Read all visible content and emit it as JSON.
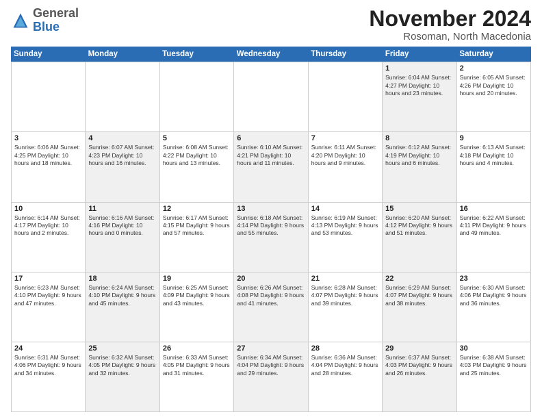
{
  "logo": {
    "general": "General",
    "blue": "Blue"
  },
  "title": "November 2024",
  "subtitle": "Rosoman, North Macedonia",
  "days_of_week": [
    "Sunday",
    "Monday",
    "Tuesday",
    "Wednesday",
    "Thursday",
    "Friday",
    "Saturday"
  ],
  "weeks": [
    [
      {
        "day": "",
        "info": "",
        "shaded": false,
        "empty": true
      },
      {
        "day": "",
        "info": "",
        "shaded": false,
        "empty": true
      },
      {
        "day": "",
        "info": "",
        "shaded": false,
        "empty": true
      },
      {
        "day": "",
        "info": "",
        "shaded": false,
        "empty": true
      },
      {
        "day": "",
        "info": "",
        "shaded": false,
        "empty": true
      },
      {
        "day": "1",
        "info": "Sunrise: 6:04 AM\nSunset: 4:27 PM\nDaylight: 10 hours\nand 23 minutes.",
        "shaded": true
      },
      {
        "day": "2",
        "info": "Sunrise: 6:05 AM\nSunset: 4:26 PM\nDaylight: 10 hours\nand 20 minutes.",
        "shaded": false
      }
    ],
    [
      {
        "day": "3",
        "info": "Sunrise: 6:06 AM\nSunset: 4:25 PM\nDaylight: 10 hours\nand 18 minutes.",
        "shaded": false
      },
      {
        "day": "4",
        "info": "Sunrise: 6:07 AM\nSunset: 4:23 PM\nDaylight: 10 hours\nand 16 minutes.",
        "shaded": true
      },
      {
        "day": "5",
        "info": "Sunrise: 6:08 AM\nSunset: 4:22 PM\nDaylight: 10 hours\nand 13 minutes.",
        "shaded": false
      },
      {
        "day": "6",
        "info": "Sunrise: 6:10 AM\nSunset: 4:21 PM\nDaylight: 10 hours\nand 11 minutes.",
        "shaded": true
      },
      {
        "day": "7",
        "info": "Sunrise: 6:11 AM\nSunset: 4:20 PM\nDaylight: 10 hours\nand 9 minutes.",
        "shaded": false
      },
      {
        "day": "8",
        "info": "Sunrise: 6:12 AM\nSunset: 4:19 PM\nDaylight: 10 hours\nand 6 minutes.",
        "shaded": true
      },
      {
        "day": "9",
        "info": "Sunrise: 6:13 AM\nSunset: 4:18 PM\nDaylight: 10 hours\nand 4 minutes.",
        "shaded": false
      }
    ],
    [
      {
        "day": "10",
        "info": "Sunrise: 6:14 AM\nSunset: 4:17 PM\nDaylight: 10 hours\nand 2 minutes.",
        "shaded": false
      },
      {
        "day": "11",
        "info": "Sunrise: 6:16 AM\nSunset: 4:16 PM\nDaylight: 10 hours\nand 0 minutes.",
        "shaded": true
      },
      {
        "day": "12",
        "info": "Sunrise: 6:17 AM\nSunset: 4:15 PM\nDaylight: 9 hours\nand 57 minutes.",
        "shaded": false
      },
      {
        "day": "13",
        "info": "Sunrise: 6:18 AM\nSunset: 4:14 PM\nDaylight: 9 hours\nand 55 minutes.",
        "shaded": true
      },
      {
        "day": "14",
        "info": "Sunrise: 6:19 AM\nSunset: 4:13 PM\nDaylight: 9 hours\nand 53 minutes.",
        "shaded": false
      },
      {
        "day": "15",
        "info": "Sunrise: 6:20 AM\nSunset: 4:12 PM\nDaylight: 9 hours\nand 51 minutes.",
        "shaded": true
      },
      {
        "day": "16",
        "info": "Sunrise: 6:22 AM\nSunset: 4:11 PM\nDaylight: 9 hours\nand 49 minutes.",
        "shaded": false
      }
    ],
    [
      {
        "day": "17",
        "info": "Sunrise: 6:23 AM\nSunset: 4:10 PM\nDaylight: 9 hours\nand 47 minutes.",
        "shaded": false
      },
      {
        "day": "18",
        "info": "Sunrise: 6:24 AM\nSunset: 4:10 PM\nDaylight: 9 hours\nand 45 minutes.",
        "shaded": true
      },
      {
        "day": "19",
        "info": "Sunrise: 6:25 AM\nSunset: 4:09 PM\nDaylight: 9 hours\nand 43 minutes.",
        "shaded": false
      },
      {
        "day": "20",
        "info": "Sunrise: 6:26 AM\nSunset: 4:08 PM\nDaylight: 9 hours\nand 41 minutes.",
        "shaded": true
      },
      {
        "day": "21",
        "info": "Sunrise: 6:28 AM\nSunset: 4:07 PM\nDaylight: 9 hours\nand 39 minutes.",
        "shaded": false
      },
      {
        "day": "22",
        "info": "Sunrise: 6:29 AM\nSunset: 4:07 PM\nDaylight: 9 hours\nand 38 minutes.",
        "shaded": true
      },
      {
        "day": "23",
        "info": "Sunrise: 6:30 AM\nSunset: 4:06 PM\nDaylight: 9 hours\nand 36 minutes.",
        "shaded": false
      }
    ],
    [
      {
        "day": "24",
        "info": "Sunrise: 6:31 AM\nSunset: 4:06 PM\nDaylight: 9 hours\nand 34 minutes.",
        "shaded": false
      },
      {
        "day": "25",
        "info": "Sunrise: 6:32 AM\nSunset: 4:05 PM\nDaylight: 9 hours\nand 32 minutes.",
        "shaded": true
      },
      {
        "day": "26",
        "info": "Sunrise: 6:33 AM\nSunset: 4:05 PM\nDaylight: 9 hours\nand 31 minutes.",
        "shaded": false
      },
      {
        "day": "27",
        "info": "Sunrise: 6:34 AM\nSunset: 4:04 PM\nDaylight: 9 hours\nand 29 minutes.",
        "shaded": true
      },
      {
        "day": "28",
        "info": "Sunrise: 6:36 AM\nSunset: 4:04 PM\nDaylight: 9 hours\nand 28 minutes.",
        "shaded": false
      },
      {
        "day": "29",
        "info": "Sunrise: 6:37 AM\nSunset: 4:03 PM\nDaylight: 9 hours\nand 26 minutes.",
        "shaded": true
      },
      {
        "day": "30",
        "info": "Sunrise: 6:38 AM\nSunset: 4:03 PM\nDaylight: 9 hours\nand 25 minutes.",
        "shaded": false
      }
    ]
  ]
}
